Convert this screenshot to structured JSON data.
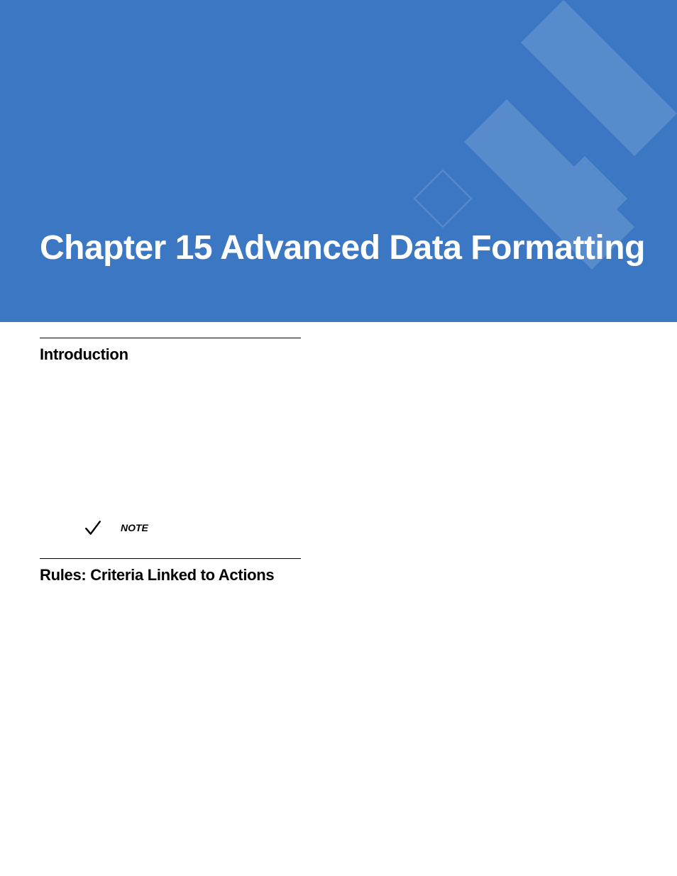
{
  "header": {
    "chapter_title": "Chapter 15 Advanced Data Formatting"
  },
  "sections": {
    "intro_heading": "Introduction",
    "rules_heading": "Rules: Criteria Linked to Actions"
  },
  "note": {
    "label": "NOTE"
  }
}
